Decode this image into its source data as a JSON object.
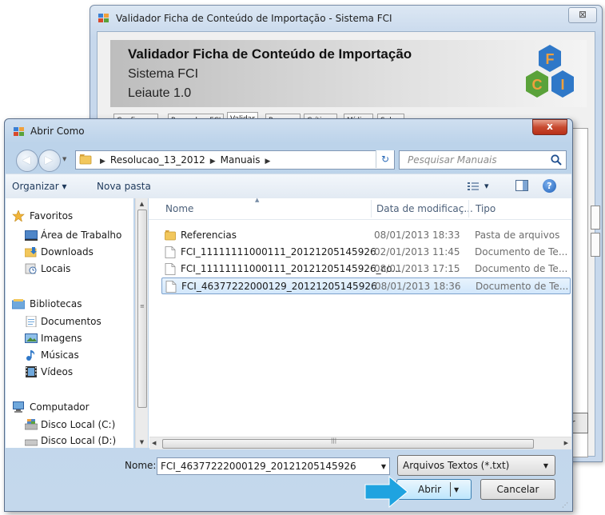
{
  "background_window": {
    "title": "Validador Ficha de Conteúdo de Importação - Sistema FCI",
    "close_label": "⊠",
    "header_title": "Validador Ficha de Conteúdo de Importação",
    "header_subtitle": "Sistema FCI",
    "header_layout": "Leiaute 1.0",
    "logo_letters": [
      "F",
      "C",
      "I"
    ],
    "tabs": [
      "Configurar",
      "Preencher FCI",
      "Validar",
      "Resumo",
      "Críticas",
      "Mídias",
      "Sobre"
    ],
    "active_tab": "Validar",
    "edge_button_label": "r"
  },
  "dialog": {
    "title": "Abrir Como",
    "close_label": "x",
    "breadcrumb": [
      "Resolucao_13_2012",
      "Manuais"
    ],
    "search_placeholder": "Pesquisar Manuais",
    "toolbar": {
      "organize_label": "Organizar ▾",
      "new_folder_label": "Nova pasta",
      "views_dropdown": "▾",
      "help_label": "?"
    },
    "nav_pane": {
      "favorites": {
        "label": "Favoritos",
        "items": [
          "Área de Trabalho",
          "Downloads",
          "Locais"
        ]
      },
      "libraries": {
        "label": "Bibliotecas",
        "items": [
          "Documentos",
          "Imagens",
          "Músicas",
          "Vídeos"
        ]
      },
      "computer": {
        "label": "Computador",
        "items": [
          "Disco Local (C:)",
          "Disco Local (D:)"
        ]
      }
    },
    "columns": {
      "name": "Nome",
      "date": "Data de modificaç...",
      "type": "Tipo"
    },
    "files": [
      {
        "name": "Referencias",
        "date": "08/01/2013 18:33",
        "type": "Pasta de arquivos",
        "kind": "folder",
        "selected": false
      },
      {
        "name": "FCI_11111111000111_20121205145926",
        "date": "02/01/2013 11:45",
        "type": "Documento de Te...",
        "kind": "text",
        "selected": false
      },
      {
        "name": "FCI_11111111000111_20121205145926_co...",
        "date": "08/01/2013 17:15",
        "type": "Documento de Te...",
        "kind": "text",
        "selected": false
      },
      {
        "name": "FCI_46377222000129_20121205145926",
        "date": "08/01/2013 18:36",
        "type": "Documento de Te...",
        "kind": "text",
        "selected": true
      }
    ],
    "filename_label": "Nome:",
    "filename_value": "FCI_46377222000129_20121205145926",
    "filetype_value": "Arquivos Textos (*.txt)",
    "open_label": "Abrir",
    "cancel_label": "Cancelar",
    "scroll_grip": "|||"
  },
  "colors": {
    "accent_blue": "#1fa3e0",
    "selection": "#cde6fb",
    "logo_orange": "#f0a03c",
    "logo_green": "#5aa23a",
    "logo_blue": "#2f78c8"
  }
}
